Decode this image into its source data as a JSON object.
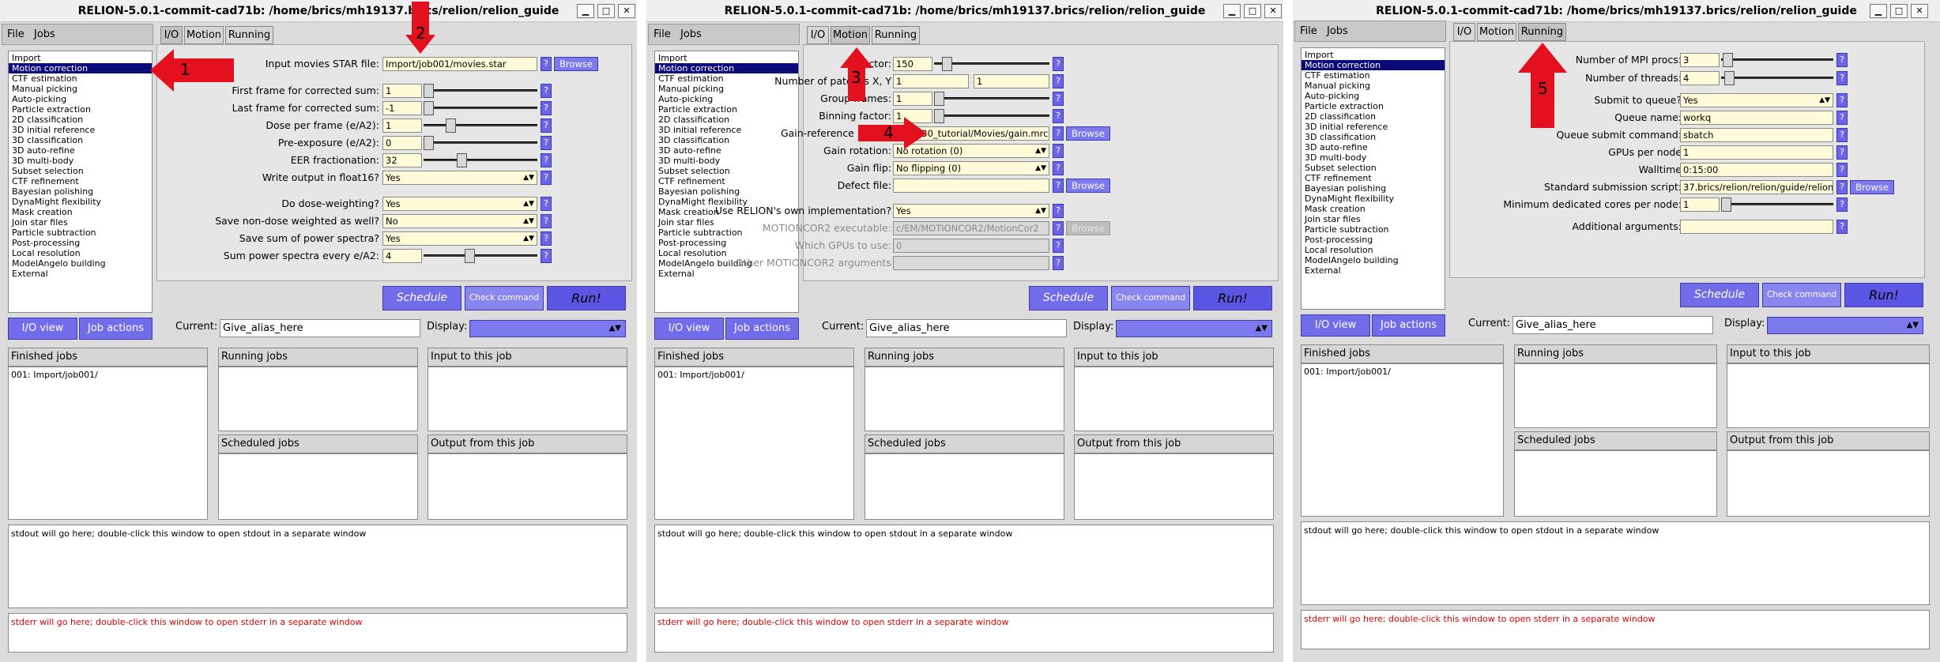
{
  "window": {
    "title": "RELION-5.0.1-commit-cad71b: /home/brics/mh19137.brics/relion/relion_guide",
    "minimize_symbol": "▁",
    "maximize_symbol": "□",
    "close_symbol": "✕"
  },
  "menu": {
    "file": "File",
    "jobs": "Jobs"
  },
  "jobs": [
    "Import",
    "Motion correction",
    "CTF estimation",
    "Manual picking",
    "Auto-picking",
    "Particle extraction",
    "2D classification",
    "3D initial reference",
    "3D classification",
    "3D auto-refine",
    "3D multi-body",
    "Subset selection",
    "CTF refinement",
    "Bayesian polishing",
    "DynaMight flexibility",
    "Mask creation",
    "Join star files",
    "Particle subtraction",
    "Post-processing",
    "Local resolution",
    "ModelAngelo building",
    "External"
  ],
  "tabs": {
    "io": "I/O",
    "motion": "Motion",
    "running": "Running"
  },
  "help": "?",
  "browse": "Browse",
  "io_form": {
    "input_movies_label": "Input movies STAR file:",
    "input_movies_value": "Import/job001/movies.star",
    "first_frame_label": "First frame for corrected sum:",
    "first_frame_value": "1",
    "last_frame_label": "Last frame for corrected sum:",
    "last_frame_value": "-1",
    "dose_label": "Dose per frame (e/A2):",
    "dose_value": "1",
    "preexp_label": "Pre-exposure (e/A2):",
    "preexp_value": "0",
    "eer_label": "EER fractionation:",
    "eer_value": "32",
    "float16_label": "Write output in float16?",
    "float16_value": "Yes",
    "doseweight_label": "Do dose-weighting?",
    "doseweight_value": "Yes",
    "nondose_label": "Save non-dose weighted as well?",
    "nondose_value": "No",
    "powerspec_label": "Save sum of power spectra?",
    "powerspec_value": "Yes",
    "sumpower_label": "Sum power spectra every e/A2:",
    "sumpower_value": "4"
  },
  "motion_form": {
    "bfactor_label": "Bfactor:",
    "bfactor_value": "150",
    "patches_label": "Number of patches X, Y",
    "patches_x": "1",
    "patches_y": "1",
    "group_label": "Group frames:",
    "group_value": "1",
    "binning_label": "Binning factor:",
    "binning_value": "1",
    "gainref_label": "Gain-reference image:",
    "gainref_value": "relion30_tutorial/Movies/gain.mrc",
    "gainrot_label": "Gain rotation:",
    "gainrot_value": "No rotation (0)",
    "gainflip_label": "Gain flip:",
    "gainflip_value": "No flipping (0)",
    "defect_label": "Defect file:",
    "defect_value": "",
    "ownimpl_label": "Use RELION's own implementation?",
    "ownimpl_value": "Yes",
    "mc2exe_label": "MOTIONCOR2 executable:",
    "mc2exe_value": "c/EM/MOTIONCOR2/MotionCor2",
    "gpus_label": "Which GPUs to use:",
    "gpus_value": "0",
    "other_label": "Other MOTIONCOR2 arguments",
    "other_value": ""
  },
  "running_form": {
    "mpi_label": "Number of MPI procs:",
    "mpi_value": "3",
    "threads_label": "Number of threads:",
    "threads_value": "4",
    "submit_label": "Submit to queue?",
    "submit_value": "Yes",
    "queue_label": "Queue name:",
    "queue_value": "workq",
    "qsub_label": "Queue submit command:",
    "qsub_value": "sbatch",
    "gpus_label": "GPUs per node",
    "gpus_value": "1",
    "walltime_label": "Walltime",
    "walltime_value": "0:15:00",
    "script_label": "Standard submission script:",
    "script_value": "37.brics/relion/relion/guide/relion_",
    "mincores_label": "Minimum dedicated cores per node:",
    "mincores_value": "1",
    "addargs_label": "Additional arguments:",
    "addargs_value": ""
  },
  "buttons": {
    "schedule": "Schedule",
    "check": "Check command",
    "run": "Run!",
    "io_view": "I/O view",
    "job_actions": "Job actions"
  },
  "current": {
    "label": "Current:",
    "value": "Give_alias_here",
    "display_label": "Display:"
  },
  "boxes": {
    "finished": "Finished jobs",
    "finished_item": "001: Import/job001/",
    "running": "Running jobs",
    "input": "Input to this job",
    "scheduled": "Scheduled jobs",
    "output": "Output from this job"
  },
  "stdout": "stdout will go here; double-click this window to open stdout in a separate window",
  "stderr": "stderr will go here; double-click this window to open stderr in a separate window",
  "annotations": [
    "1",
    "2",
    "3",
    "4",
    "5"
  ],
  "colors": {
    "arrow": "#e3101d",
    "button": "#716ce9",
    "input": "#fffbd9",
    "selection": "#0a0a7a"
  }
}
